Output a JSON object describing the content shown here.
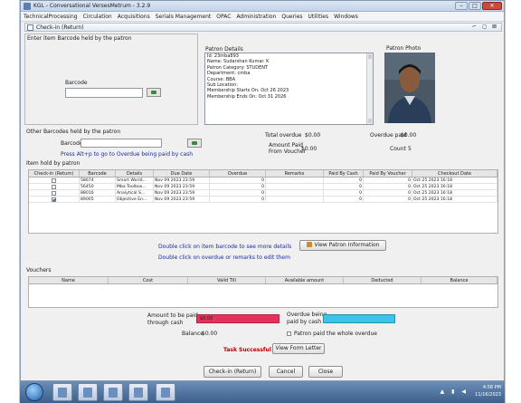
{
  "window": {
    "title": "KGL - Conversational VersesMetrum - 3.2.9",
    "minimize": "‒",
    "maximize": "□",
    "close": "✕"
  },
  "menu": [
    "TechnicalProcessing",
    "Circulation",
    "Acquisitions",
    "Serials Management",
    "OPAC",
    "Administration",
    "Queries",
    "Utilities",
    "Windows"
  ],
  "frame": {
    "title": "Check-in (Return)",
    "controls": "⌐ ◻ ⊠"
  },
  "barcode_section": {
    "heading": "Enter item Barcode held by the patron",
    "label": "Barcode",
    "value": ""
  },
  "patron": {
    "heading": "Patron Details",
    "photo_heading": "Patron Photo",
    "lines": [
      "Id: 23mba893",
      "Name: Sudarshan Kumar. K",
      "Patron Category: STUDENT",
      "Department: cmba",
      "Course: BBA",
      "Sub Location:",
      "Membership Starts On: Oct 26 2023",
      "Membership Ends On: Oct 31 2026"
    ]
  },
  "other_barcodes": {
    "heading": "Other Barcodes held by the patron",
    "label": "Barcode",
    "hint": "Press Alt+p to go to Overdue being paid by cash"
  },
  "totals": {
    "total_overdue_label": "Total overdue",
    "total_overdue_value": "$0.00",
    "overdue_paid_label": "Overdue paid",
    "overdue_paid_value": "$0.00",
    "amount_paid_label_1": "Amount Paid",
    "amount_paid_label_2": "From Voucher",
    "amount_paid_value": "$0.00",
    "count_label": "Count",
    "count_value": "5"
  },
  "items": {
    "heading": "Item hold by patron",
    "columns": [
      "Check-in (Return)",
      "Barcode",
      "Details",
      "Due Date",
      "Overdue",
      "Remarks",
      "Paid By Cash",
      "Paid By Voucher",
      "Checkout Date"
    ],
    "rows": [
      {
        "checked": false,
        "barcode": "58674",
        "details": "Smart World...",
        "due": "Nov 09 2023 23:59",
        "overdue": "0",
        "remarks": "",
        "cash": "0",
        "voucher": "0",
        "checkout": "Oct 25 2023 16:18"
      },
      {
        "checked": false,
        "barcode": "56450",
        "details": "Mba Toolbox...",
        "due": "Nov 09 2023 23:59",
        "overdue": "0",
        "remarks": "",
        "cash": "0",
        "voucher": "0",
        "checkout": "Oct 25 2023 16:18"
      },
      {
        "checked": false,
        "barcode": "88016",
        "details": "Analytical S...",
        "due": "Nov 09 2023 23:59",
        "overdue": "0",
        "remarks": "",
        "cash": "0",
        "voucher": "0",
        "checkout": "Oct 25 2023 16:18"
      },
      {
        "checked": true,
        "barcode": "89005",
        "details": "Objective En...",
        "due": "Nov 09 2023 23:59",
        "overdue": "0",
        "remarks": "",
        "cash": "0",
        "voucher": "0",
        "checkout": "Oct 25 2023 16:18"
      }
    ]
  },
  "hints": {
    "double_click_barcode": "Double click on item barcode to see more details",
    "double_click_overdue": "Double click on overdue or remarks to edit them",
    "view_patron_button": "View Patron Information"
  },
  "vouchers": {
    "heading": "Vouchers",
    "columns": [
      "Name",
      "Cost",
      "Valid Till",
      "Available amount",
      "Deducted",
      "Balance"
    ]
  },
  "payment": {
    "amount_cash_label_1": "Amount to be paid",
    "amount_cash_label_2": "through cash",
    "amount_cash_value": "$0.00",
    "overdue_cash_label_1": "Overdue being",
    "overdue_cash_label_2": "paid by cash",
    "balance_label": "Balance",
    "balance_value": "$0.00",
    "pay_whole_label": "Patron paid the whole overdue",
    "colors": {
      "amount_bar": "#e8315a",
      "overdue_bar": "#39c4e8"
    }
  },
  "status": {
    "message": "Task Successful",
    "view_form_letter": "View Form Letter"
  },
  "buttons": {
    "checkin": "Check-in (Return)",
    "cancel": "Cancel",
    "close": "Close"
  },
  "taskbar": {
    "time": "4:58 PM",
    "date": "11/16/2023",
    "tray_icons": "▲ ▮ ◀"
  }
}
